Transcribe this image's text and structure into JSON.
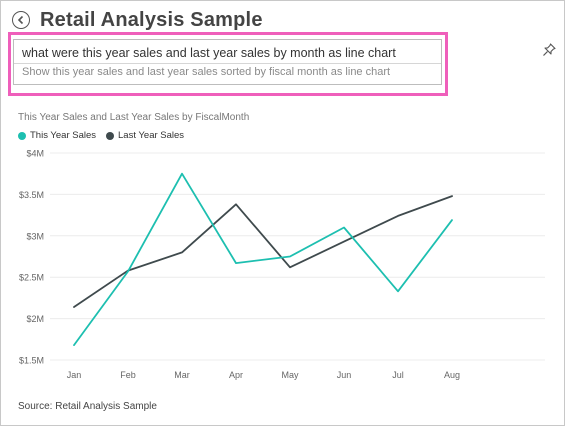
{
  "header": {
    "title": "Retail Analysis Sample"
  },
  "qa": {
    "question": "what were this year sales and last year sales by month as line chart",
    "suggestion": "Show this year sales and last year sales sorted by fiscal month as line chart"
  },
  "chart_title": "This Year Sales and Last Year Sales by FiscalMonth",
  "source": "Source: Retail Analysis Sample",
  "colors": {
    "this_year": "#1dbfb0",
    "last_year": "#3f4a4d",
    "highlight": "#ef5fbb"
  },
  "icons": {
    "back": "back-arrow-icon",
    "pin": "pin-icon"
  },
  "chart_data": {
    "type": "line",
    "categories": [
      "Jan",
      "Feb",
      "Mar",
      "Apr",
      "May",
      "Jun",
      "Jul",
      "Aug"
    ],
    "series": [
      {
        "name": "This Year Sales",
        "values": [
          1.68,
          2.57,
          3.75,
          2.67,
          2.75,
          3.1,
          2.33,
          3.19
        ]
      },
      {
        "name": "Last Year Sales",
        "values": [
          2.14,
          2.58,
          2.8,
          3.38,
          2.62,
          2.93,
          3.24,
          3.48
        ]
      }
    ],
    "y_ticks": [
      "$4M",
      "$3.5M",
      "$3M",
      "$2.5M",
      "$2M",
      "$1.5M"
    ],
    "ylim": [
      1.5,
      4
    ],
    "grid": true,
    "legend_position": "top-left"
  }
}
